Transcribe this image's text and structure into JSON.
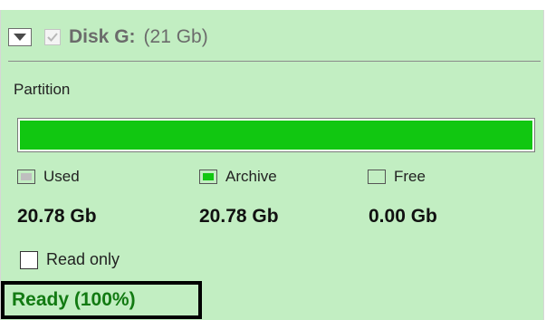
{
  "header": {
    "disk_name": "Disk G:",
    "disk_size": "(21 Gb)",
    "checked": true
  },
  "partition": {
    "label": "Partition",
    "used_fraction": 1.0,
    "bar_color": "#11c711"
  },
  "legend": [
    {
      "label": "Used",
      "color": "#bfbfbf",
      "value": "20.78 Gb"
    },
    {
      "label": "Archive",
      "color": "#11c711",
      "value": "20.78 Gb"
    },
    {
      "label": "Free",
      "color": "#ffffff",
      "value": "0.00 Gb"
    }
  ],
  "read_only": {
    "label": "Read only",
    "checked": false
  },
  "status": {
    "text": "Ready (100%)",
    "color": "#127a12"
  },
  "colors": {
    "panel_bg": "#c2eec2"
  }
}
